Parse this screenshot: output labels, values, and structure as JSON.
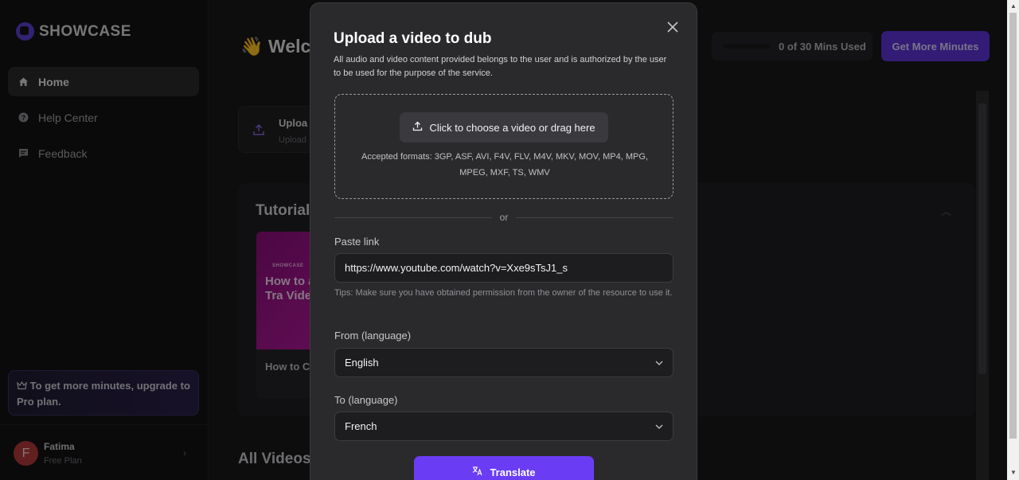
{
  "app": {
    "brand": "SHOWCASE"
  },
  "sidebar": {
    "items": [
      {
        "label": "Home",
        "icon": "home-icon",
        "active": true
      },
      {
        "label": "Help Center",
        "icon": "help-icon",
        "active": false
      },
      {
        "label": "Feedback",
        "icon": "feedback-icon",
        "active": false
      }
    ],
    "upgrade_text": "To get more minutes, upgrade to Pro plan.",
    "user": {
      "initial": "F",
      "name": "Fatima",
      "plan": "Free Plan"
    }
  },
  "header": {
    "welcome": "👋 Welco",
    "usage": "0 of 30 Mins Used",
    "usage_progress": 0,
    "more_minutes_button": "Get More Minutes"
  },
  "upload_card": {
    "title": "Uploa",
    "subtitle": "Upload"
  },
  "tutorial": {
    "title": "Tutorial",
    "card": {
      "thumb_brand": "SHOWCASE",
      "thumb_text": "How to and Tra Videos",
      "caption": "How to C"
    }
  },
  "all_videos": {
    "title": "All Videos"
  },
  "modal": {
    "title": "Upload a video to dub",
    "description": "All audio and video content provided belongs to the user and is authorized by the user to be used for the purpose of the service.",
    "choose_button": "Click to choose a video or drag here",
    "formats": "Accepted formats: 3GP, ASF, AVI, F4V, FLV, M4V, MKV, MOV, MP4, MPG, MPEG, MXF, TS, WMV",
    "or": "or",
    "paste_link_label": "Paste link",
    "paste_link_value": "https://www.youtube.com/watch?v=Xxe9sTsJ1_s",
    "tips": "Tips: Make sure you have obtained permission from the owner of the resource to use it.",
    "from_label": "From (language)",
    "from_value": "English",
    "to_label": "To (language)",
    "to_value": "French",
    "translate_button": "Translate"
  },
  "colors": {
    "accent": "#6a3df5",
    "modal_bg": "#2a2a2c",
    "app_bg": "#18181a"
  }
}
